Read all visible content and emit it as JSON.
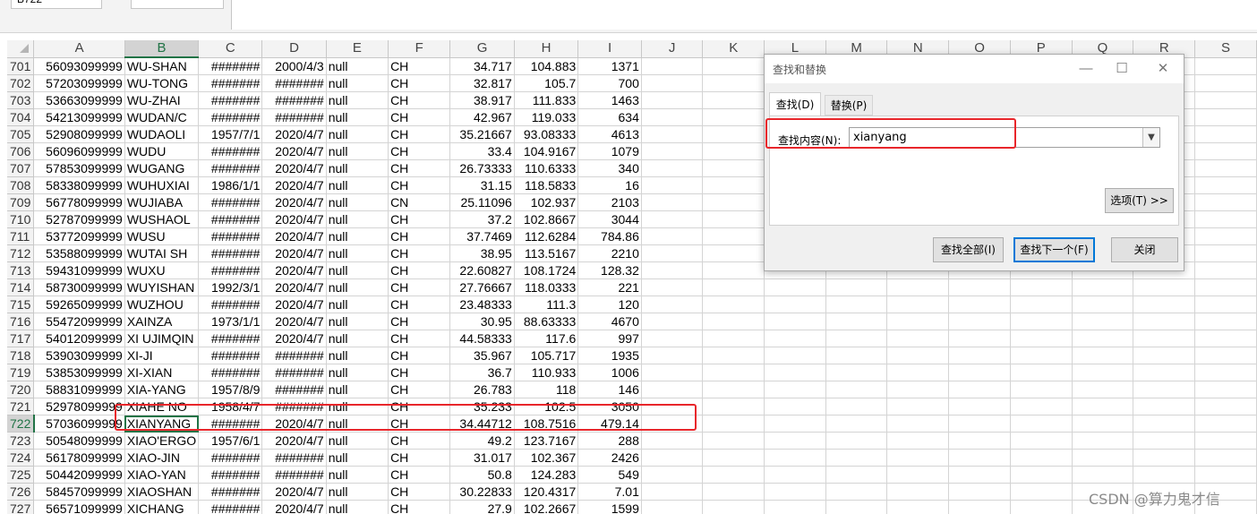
{
  "formula_bar": {
    "name_box": "B722",
    "formula_value": "XIANYANG"
  },
  "columns": [
    "A",
    "B",
    "C",
    "D",
    "E",
    "F",
    "G",
    "H",
    "I",
    "J",
    "K",
    "L",
    "M",
    "N",
    "O",
    "P",
    "Q",
    "R",
    "S"
  ],
  "active_column": "B",
  "active_row": "722",
  "rows": [
    {
      "n": "701",
      "a": "56093099999",
      "b": "WU-SHAN",
      "c": "#######",
      "d": "2000/4/3",
      "e": "null",
      "f": "CH",
      "g": "34.717",
      "h": "104.883",
      "i": "1371"
    },
    {
      "n": "702",
      "a": "57203099999",
      "b": "WU-TONG",
      "c": "#######",
      "d": "#######",
      "e": "null",
      "f": "CH",
      "g": "32.817",
      "h": "105.7",
      "i": "700"
    },
    {
      "n": "703",
      "a": "53663099999",
      "b": "WU-ZHAI",
      "c": "#######",
      "d": "#######",
      "e": "null",
      "f": "CH",
      "g": "38.917",
      "h": "111.833",
      "i": "1463"
    },
    {
      "n": "704",
      "a": "54213099999",
      "b": "WUDAN/C",
      "c": "#######",
      "d": "#######",
      "e": "null",
      "f": "CH",
      "g": "42.967",
      "h": "119.033",
      "i": "634"
    },
    {
      "n": "705",
      "a": "52908099999",
      "b": "WUDAOLI",
      "c": "1957/7/1",
      "d": "2020/4/7",
      "e": "null",
      "f": "CH",
      "g": "35.21667",
      "h": "93.08333",
      "i": "4613"
    },
    {
      "n": "706",
      "a": "56096099999",
      "b": "WUDU",
      "c": "#######",
      "d": "2020/4/7",
      "e": "null",
      "f": "CH",
      "g": "33.4",
      "h": "104.9167",
      "i": "1079"
    },
    {
      "n": "707",
      "a": "57853099999",
      "b": "WUGANG",
      "c": "#######",
      "d": "2020/4/7",
      "e": "null",
      "f": "CH",
      "g": "26.73333",
      "h": "110.6333",
      "i": "340"
    },
    {
      "n": "708",
      "a": "58338099999",
      "b": "WUHUXIAI",
      "c": "1986/1/1",
      "d": "2020/4/7",
      "e": "null",
      "f": "CH",
      "g": "31.15",
      "h": "118.5833",
      "i": "16"
    },
    {
      "n": "709",
      "a": "56778099999",
      "b": "WUJIABA",
      "c": "#######",
      "d": "2020/4/7",
      "e": "null",
      "f": "CN",
      "g": "25.11096",
      "h": "102.937",
      "i": "2103"
    },
    {
      "n": "710",
      "a": "52787099999",
      "b": "WUSHAOL",
      "c": "#######",
      "d": "2020/4/7",
      "e": "null",
      "f": "CH",
      "g": "37.2",
      "h": "102.8667",
      "i": "3044"
    },
    {
      "n": "711",
      "a": "53772099999",
      "b": "WUSU",
      "c": "#######",
      "d": "2020/4/7",
      "e": "null",
      "f": "CH",
      "g": "37.7469",
      "h": "112.6284",
      "i": "784.86"
    },
    {
      "n": "712",
      "a": "53588099999",
      "b": "WUTAI SH",
      "c": "#######",
      "d": "2020/4/7",
      "e": "null",
      "f": "CH",
      "g": "38.95",
      "h": "113.5167",
      "i": "2210"
    },
    {
      "n": "713",
      "a": "59431099999",
      "b": "WUXU",
      "c": "#######",
      "d": "2020/4/7",
      "e": "null",
      "f": "CH",
      "g": "22.60827",
      "h": "108.1724",
      "i": "128.32"
    },
    {
      "n": "714",
      "a": "58730099999",
      "b": "WUYISHAN",
      "c": "1992/3/1",
      "d": "2020/4/7",
      "e": "null",
      "f": "CH",
      "g": "27.76667",
      "h": "118.0333",
      "i": "221"
    },
    {
      "n": "715",
      "a": "59265099999",
      "b": "WUZHOU",
      "c": "#######",
      "d": "2020/4/7",
      "e": "null",
      "f": "CH",
      "g": "23.48333",
      "h": "111.3",
      "i": "120"
    },
    {
      "n": "716",
      "a": "55472099999",
      "b": "XAINZA",
      "c": "1973/1/1",
      "d": "2020/4/7",
      "e": "null",
      "f": "CH",
      "g": "30.95",
      "h": "88.63333",
      "i": "4670"
    },
    {
      "n": "717",
      "a": "54012099999",
      "b": "XI UJIMQIN",
      "c": "#######",
      "d": "2020/4/7",
      "e": "null",
      "f": "CH",
      "g": "44.58333",
      "h": "117.6",
      "i": "997"
    },
    {
      "n": "718",
      "a": "53903099999",
      "b": "XI-JI",
      "c": "#######",
      "d": "#######",
      "e": "null",
      "f": "CH",
      "g": "35.967",
      "h": "105.717",
      "i": "1935"
    },
    {
      "n": "719",
      "a": "53853099999",
      "b": "XI-XIAN",
      "c": "#######",
      "d": "#######",
      "e": "null",
      "f": "CH",
      "g": "36.7",
      "h": "110.933",
      "i": "1006"
    },
    {
      "n": "720",
      "a": "58831099999",
      "b": "XIA-YANG",
      "c": "1957/8/9",
      "d": "#######",
      "e": "null",
      "f": "CH",
      "g": "26.783",
      "h": "118",
      "i": "146"
    },
    {
      "n": "721",
      "a": "52978099999",
      "b": "XIAHE NO",
      "c": "1958/4/7",
      "d": "#######",
      "e": "null",
      "f": "CH",
      "g": "35.233",
      "h": "102.5",
      "i": "3050"
    },
    {
      "n": "722",
      "a": "57036099999",
      "b": "XIANYANG",
      "c": "#######",
      "d": "2020/4/7",
      "e": "null",
      "f": "CH",
      "g": "34.44712",
      "h": "108.7516",
      "i": "479.14"
    },
    {
      "n": "723",
      "a": "50548099999",
      "b": "XIAO'ERGO",
      "c": "1957/6/1",
      "d": "2020/4/7",
      "e": "null",
      "f": "CH",
      "g": "49.2",
      "h": "123.7167",
      "i": "288"
    },
    {
      "n": "724",
      "a": "56178099999",
      "b": "XIAO-JIN",
      "c": "#######",
      "d": "#######",
      "e": "null",
      "f": "CH",
      "g": "31.017",
      "h": "102.367",
      "i": "2426"
    },
    {
      "n": "725",
      "a": "50442099999",
      "b": "XIAO-YAN",
      "c": "#######",
      "d": "#######",
      "e": "null",
      "f": "CH",
      "g": "50.8",
      "h": "124.283",
      "i": "549"
    },
    {
      "n": "726",
      "a": "58457099999",
      "b": "XIAOSHAN",
      "c": "#######",
      "d": "2020/4/7",
      "e": "null",
      "f": "CH",
      "g": "30.22833",
      "h": "120.4317",
      "i": "7.01"
    },
    {
      "n": "727",
      "a": "56571099999",
      "b": "XICHANG",
      "c": "#######",
      "d": "2020/4/7",
      "e": "null",
      "f": "CH",
      "g": "27.9",
      "h": "102.2667",
      "i": "1599"
    }
  ],
  "dialog": {
    "title": "查找和替换",
    "minimize": "—",
    "maximize": "☐",
    "close": "✕",
    "tab_find": "查找(D)",
    "tab_replace": "替换(P)",
    "find_label": "查找内容(N):",
    "find_value": "xianyang",
    "options_label": "选项(T) >>",
    "find_all_label": "查找全部(I)",
    "find_next_label": "查找下一个(F)",
    "close_label": "关闭"
  },
  "colors": {
    "highlight_red": "#e8262b",
    "excel_green": "#217346",
    "focus_blue": "#0078d7"
  },
  "watermark": "CSDN @算力鬼才信"
}
